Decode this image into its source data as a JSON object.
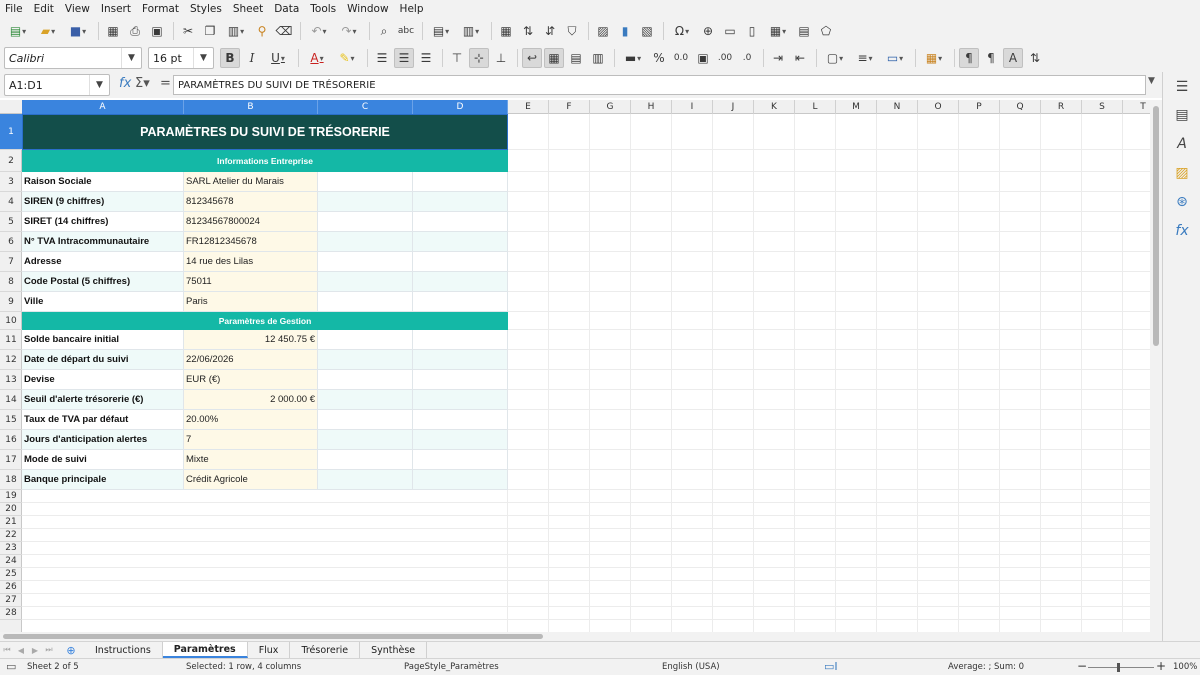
{
  "menu": [
    "File",
    "Edit",
    "View",
    "Insert",
    "Format",
    "Styles",
    "Sheet",
    "Data",
    "Tools",
    "Window",
    "Help"
  ],
  "toolbar": {
    "font_name": "Calibri",
    "font_size": "16 pt",
    "bold_label": "B",
    "italic_label": "I",
    "underline_label": "U"
  },
  "formula_bar": {
    "name_box": "A1:D1",
    "content": "PARAMÈTRES DU SUIVI DE TRÉSORERIE"
  },
  "columns": [
    "A",
    "B",
    "C",
    "D",
    "E",
    "F",
    "G",
    "H",
    "I",
    "J",
    "K",
    "L",
    "M",
    "N",
    "O",
    "P",
    "Q",
    "R",
    "S",
    "T"
  ],
  "rows": [
    "1",
    "2",
    "3",
    "4",
    "5",
    "6",
    "7",
    "8",
    "9",
    "10",
    "11",
    "12",
    "13",
    "14",
    "15",
    "16",
    "17",
    "18",
    "19",
    "20",
    "21",
    "22",
    "23",
    "24",
    "25",
    "26",
    "27",
    "28"
  ],
  "sheet": {
    "title": "PARAMÈTRES DU SUIVI DE TRÉSORERIE",
    "section_company": "Informations Entreprise",
    "section_management": "Paramètres de Gestion",
    "company_fields": [
      {
        "label": "Raison Sociale",
        "value": "SARL Atelier du Marais"
      },
      {
        "label": "SIREN (9 chiffres)",
        "value": "812345678"
      },
      {
        "label": "SIRET (14 chiffres)",
        "value": "81234567800024"
      },
      {
        "label": "N° TVA Intracommunautaire",
        "value": "FR12812345678"
      },
      {
        "label": "Adresse",
        "value": "14 rue des Lilas"
      },
      {
        "label": "Code Postal (5 chiffres)",
        "value": "75011"
      },
      {
        "label": "Ville",
        "value": "Paris"
      }
    ],
    "management_fields": [
      {
        "label": "Solde bancaire initial",
        "value": "12 450.75 €",
        "align": "right"
      },
      {
        "label": "Date de départ du suivi",
        "value": "22/06/2026",
        "align": "left"
      },
      {
        "label": "Devise",
        "value": "EUR (€)",
        "align": "left"
      },
      {
        "label": "Seuil d'alerte trésorerie (€)",
        "value": "2 000.00 €",
        "align": "right"
      },
      {
        "label": "Taux de TVA par défaut",
        "value": "20.00%",
        "align": "left"
      },
      {
        "label": "Jours d'anticipation alertes",
        "value": "7",
        "align": "left"
      },
      {
        "label": "Mode de suivi",
        "value": "Mixte",
        "align": "left"
      },
      {
        "label": "Banque principale",
        "value": "Crédit Agricole",
        "align": "left"
      }
    ]
  },
  "tabs": [
    "Instructions",
    "Paramètres",
    "Flux",
    "Trésorerie",
    "Synthèse"
  ],
  "active_tab": "Paramètres",
  "status": {
    "sheet": "Sheet 2 of 5",
    "selection": "Selected: 1 row, 4 columns",
    "page_style": "PageStyle_Paramètres",
    "language": "English (USA)",
    "sum": "Average: ; Sum: 0",
    "zoom": "100%"
  },
  "colors": {
    "title_bg": "#134e4a",
    "section_bg": "#14b8a6",
    "value_bg": "#fef9e7",
    "alt_row_bg": "#effaf9",
    "selection": "#3a84de"
  }
}
